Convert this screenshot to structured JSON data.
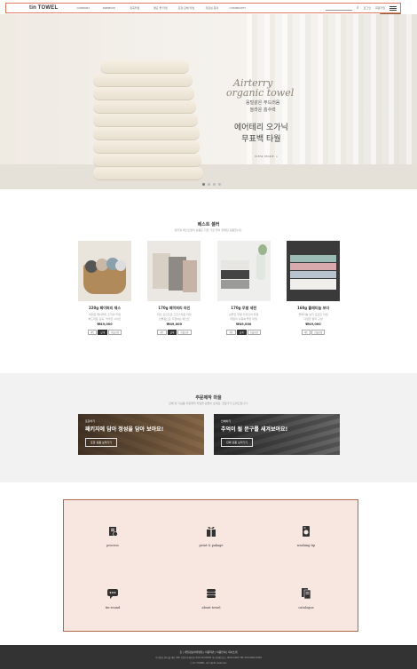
{
  "header": {
    "logo": "tin TOWEL",
    "nav": [
      "COMPANY",
      "PREMIUM",
      "판촉타월",
      "결혼·돌 타월",
      "포장·단체 타월",
      "자료실·문의",
      "COMMUNITY"
    ],
    "util_login": "로그인",
    "util_join": "회원가입",
    "join_badge": "신규회원 혜택"
  },
  "hero": {
    "script_line1": "Airterry",
    "script_line2": "organic towel",
    "line1": "융털같은 푸드러움",
    "line2": "놀라운 흡수력",
    "title1": "에어테리 오가닉",
    "title2": "무표백 타월",
    "more": "VIEW MORE >",
    "slide_count": "4"
  },
  "best": {
    "title": "베스트 셀러",
    "subtitle": "틴타월 베스트셀러 상품은 지금 가장 많이 판매된 상품입니다.",
    "products": [
      {
        "name": "220g 페이퍼리 재스",
        "desc1": "세련된 페이퍼리 조직의 타월",
        "desc2": "부드러운 감촉, 넉넉한 사이즈",
        "price": "₩49,000",
        "tags": [
          "세트",
          "낱개",
          "선물포장"
        ]
      },
      {
        "name": "170g 페이퍼리 라인",
        "desc1": "라인 포인트로 고급스러운 타월",
        "desc2": "선물용으로 추천하는 베스트",
        "price": "₩49,000",
        "tags": [
          "세트",
          "낱개",
          "선물포장"
        ]
      },
      {
        "name": "170g 무발 세련",
        "desc1": "심플한 무발 디자인의 타월",
        "desc2": "데일리 사용에 좋은 타월",
        "price": "₩49,000",
        "tags": [
          "세트",
          "낱개",
          "선물포장"
        ]
      },
      {
        "name": "160g 플레티늄 보더",
        "desc1": "플레티늄 보더 포인트 타월",
        "desc2": "다양한 컬러 구성",
        "price": "₩49,000",
        "tags": [
          "세트",
          "선물포장"
        ]
      }
    ]
  },
  "order": {
    "title": "주문제작 마을",
    "subtitle": "단체 및 기념품 주문제작 타월을 만들어 보세요. 전문가가 도와드립니다.",
    "banner1": {
      "small": "포장하기",
      "big": "패키지에 담아 정성을 담아 보아요!",
      "button": "포장 상품 보러가기"
    },
    "banner2": {
      "small": "인쇄하기",
      "big": "추억이 될 문구를 새겨보아요!",
      "button": "인쇄 상품 보러가기"
    }
  },
  "icons": [
    {
      "icon": "process-icon",
      "label": "process"
    },
    {
      "icon": "gift-icon",
      "label": "print & pakage"
    },
    {
      "icon": "washing-icon",
      "label": "washing tip"
    },
    {
      "icon": "chat-icon",
      "label": "tin-round"
    },
    {
      "icon": "towel-stack-icon",
      "label": "about towel"
    },
    {
      "icon": "catalogue-icon",
      "label": "catalogue"
    }
  ],
  "footer": {
    "links": "홈  |  개인정보처리방침  |  이용약관  |  이용안내  |  회사소개",
    "info": "주식회사 틴타월  대표 000  사업자등록번호 000-00-00000  통신판매업신고 0000-0000  TEL 000-0000-0000",
    "copyright": "ⓒ tin TOWEL. All rights reserved."
  }
}
